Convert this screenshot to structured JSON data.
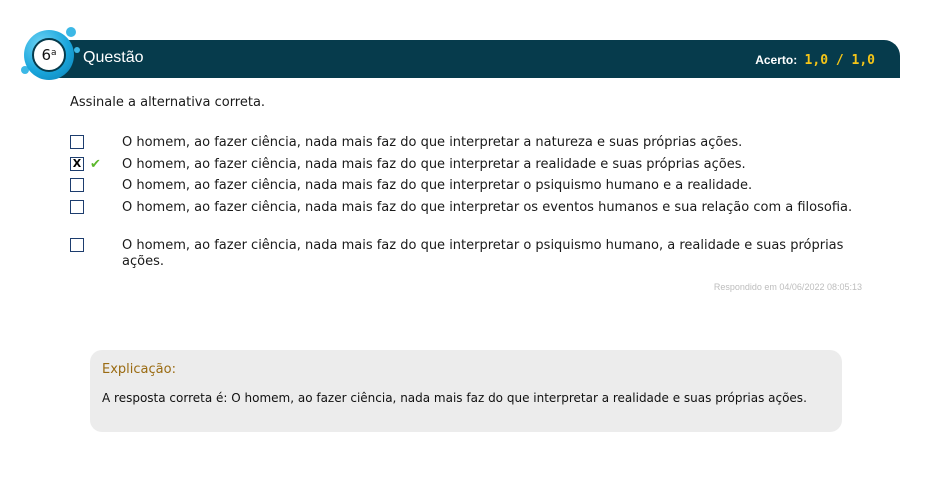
{
  "question": {
    "number": "6",
    "ordinal": "a",
    "title": "Questão",
    "score_label": "Acerto:",
    "score_value": "1,0 / 1,0"
  },
  "prompt": "Assinale a alternativa correta.",
  "alternatives": [
    {
      "text": "O homem, ao fazer ciência, nada mais faz do que interpretar a natureza e suas próprias ações.",
      "checked": false,
      "correct": false
    },
    {
      "text": "O homem, ao fazer ciência, nada mais faz do que interpretar a realidade e suas próprias ações.",
      "checked": true,
      "correct": true,
      "mark": "X"
    },
    {
      "text": "O homem, ao fazer ciência, nada mais faz do que interpretar o psiquismo humano e a realidade.",
      "checked": false,
      "correct": false
    },
    {
      "text": "O homem, ao fazer ciência, nada mais faz do que interpretar os eventos humanos e sua relação com a filosofia.",
      "checked": false,
      "correct": false
    },
    {
      "text": "O homem, ao fazer ciência, nada mais faz do que interpretar o psiquismo humano, a realidade e suas próprias ações.",
      "checked": false,
      "correct": false
    }
  ],
  "answered_at": "Respondido em 04/06/2022 08:05:13",
  "explanation": {
    "title": "Explicação:",
    "text": "A resposta correta é: O homem, ao fazer ciência, nada mais faz do que interpretar a realidade e suas próprias ações."
  },
  "colors": {
    "header_bg": "#063b4c",
    "score_value": "#f5c518",
    "checkmark": "#5cb82c",
    "explanation_title": "#9a6b12",
    "explanation_bg": "#ececec"
  },
  "icons": {
    "correct": "check-icon"
  }
}
